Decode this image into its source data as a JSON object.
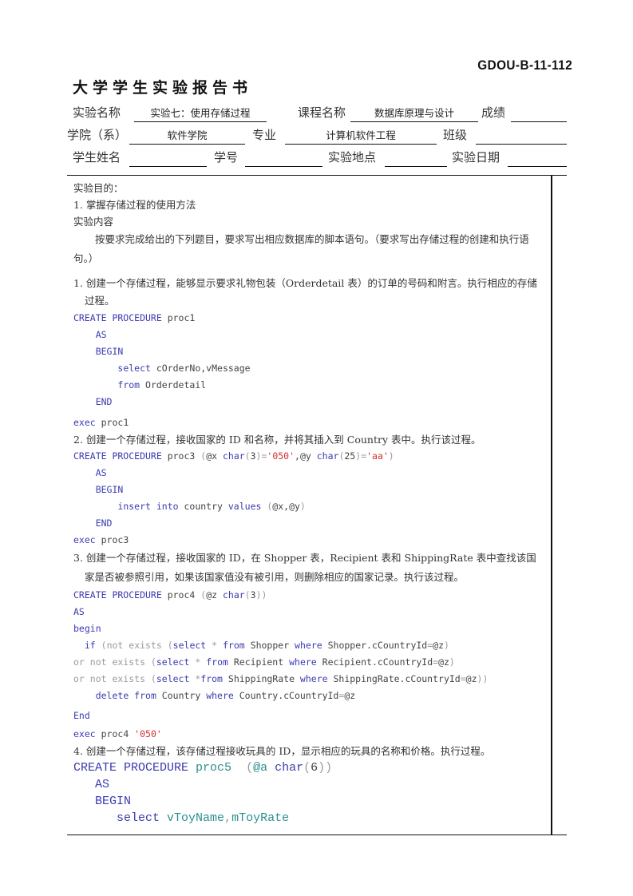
{
  "header": {
    "doc_code": "GDOU-B-11-112",
    "title": "大学学生实验报告书"
  },
  "info": {
    "experiment_name_label": "实验名称",
    "experiment_name_value": "实验七：使用存储过程",
    "course_name_label": "课程名称",
    "course_name_value": "数据库原理与设计",
    "grade_label": "成绩",
    "grade_value": "",
    "college_label": "学院（系）",
    "college_value": "软件学院",
    "major_label": "专业",
    "major_value": "计算机软件工程",
    "class_label": "班级",
    "class_value": "",
    "student_name_label": "学生姓名",
    "student_name_value": "",
    "student_id_label": "学号",
    "student_id_value": "",
    "location_label": "实验地点",
    "location_value": "",
    "date_label": "实验日期",
    "date_value": ""
  },
  "content": {
    "purpose_heading": "实验目的：",
    "purpose_item": "1.  掌握存储过程的使用方法",
    "content_heading": "实验内容",
    "instructions": "按要求完成给出的下列题目，要求写出相应数据库的脚本语句。（要求写出存储过程的创建和执行语句。）",
    "tasks": [
      {
        "text": "1.  创建一个存储过程，能够显示要求礼物包装（Orderdetail 表）的订单的号码和附言。执行相应的存储过程。",
        "code": [
          "CREATE PROCEDURE proc1",
          "AS",
          "BEGIN",
          "select cOrderNo,vMessage",
          "from Orderdetail",
          "END",
          "exec proc1"
        ]
      },
      {
        "text": "2.  创建一个存储过程，接收国家的 ID 和名称，并将其插入到 Country 表中。执行该过程。",
        "code": [
          "CREATE PROCEDURE proc3 (@x char(3)='050',@y char(25)='aa')",
          "AS",
          "BEGIN",
          "insert into country values (@x,@y)",
          "END",
          "exec proc3"
        ]
      },
      {
        "text": "3.  创建一个存储过程，接收国家的 ID，在 Shopper 表，Recipient 表和 ShippingRate 表中查找该国家是否被参照引用，如果该国家值没有被引用，则删除相应的国家记录。执行该过程。",
        "code": [
          "CREATE PROCEDURE proc4 (@z char(3))",
          "AS",
          "begin",
          "if (not exists (select * from Shopper where Shopper.cCountryId=@z)",
          "or not exists (select * from Recipient where Recipient.cCountryId=@z)",
          "or not exists (select *from ShippingRate where ShippingRate.cCountryId=@z))",
          "delete from Country where Country.cCountryId=@z",
          "End",
          "exec proc4 '050'"
        ]
      },
      {
        "text": "4.  创建一个存储过程，该存储过程接收玩具的 ID，显示相应的玩具的名称和价格。执行过程。",
        "code": [
          "CREATE PROCEDURE proc5  (@a char(6))",
          "AS",
          "BEGIN",
          "select vToyName,mToyRate"
        ]
      }
    ]
  },
  "colors": {
    "keyword": "#3b3bb0",
    "string": "#d03030",
    "comment_gray": "#9a9a9a",
    "identifier_teal": "#2a8f8f"
  }
}
